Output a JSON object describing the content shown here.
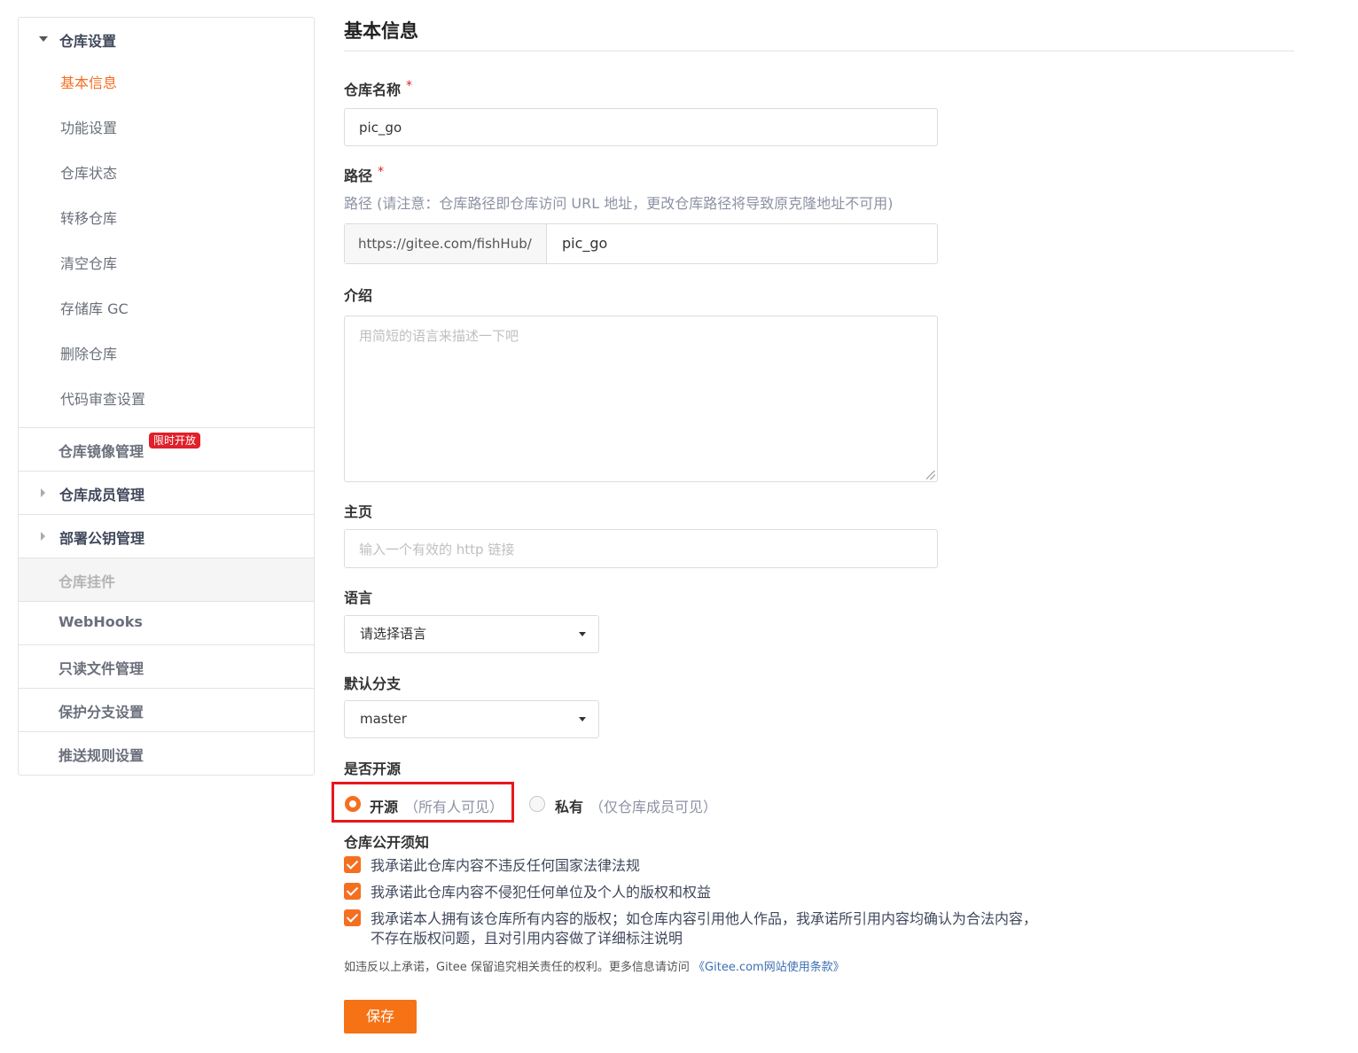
{
  "sidebar": {
    "settings_group": {
      "title": "仓库设置",
      "items": [
        "基本信息",
        "功能设置",
        "仓库状态",
        "转移仓库",
        "清空仓库",
        "存储库 GC",
        "删除仓库",
        "代码审查设置"
      ]
    },
    "mirror": {
      "title": "仓库镜像管理",
      "badge": "限时开放"
    },
    "members": {
      "title": "仓库成员管理"
    },
    "deploy_keys": {
      "title": "部署公钥管理"
    },
    "hooks": {
      "title": "仓库挂件"
    },
    "webhooks": {
      "title": "WebHooks"
    },
    "readonly": {
      "title": "只读文件管理"
    },
    "protect_branch": {
      "title": "保护分支设置"
    },
    "push_rules": {
      "title": "推送规则设置"
    }
  },
  "main": {
    "title": "基本信息",
    "repo_name": {
      "label": "仓库名称",
      "required": "*",
      "value": "pic_go"
    },
    "path": {
      "label": "路径",
      "required": "*",
      "hint": "路径 (请注意：仓库路径即仓库访问 URL 地址，更改仓库路径将导致原克隆地址不可用)",
      "prefix": "https://gitee.com/fishHub/",
      "value": "pic_go"
    },
    "intro": {
      "label": "介绍",
      "placeholder": "用简短的语言来描述一下吧"
    },
    "homepage": {
      "label": "主页",
      "placeholder": "输入一个有效的 http 链接"
    },
    "language": {
      "label": "语言",
      "selected": "请选择语言"
    },
    "default_branch": {
      "label": "默认分支",
      "selected": "master"
    },
    "visibility": {
      "label": "是否开源",
      "open_label": "开源",
      "open_note": "（所有人可见）",
      "private_label": "私有",
      "private_note": "（仅仓库成员可见）",
      "selected": "开源"
    },
    "notice": {
      "title": "仓库公开须知",
      "items": [
        "我承诺此仓库内容不违反任何国家法律法规",
        "我承诺此仓库内容不侵犯任何单位及个人的版权和权益",
        "我承诺本人拥有该仓库所有内容的版权；如仓库内容引用他人作品，我承诺所引用内容均确认为合法内容，",
        "不存在版权问题，且对引用内容做了详细标注说明"
      ],
      "footer": "如违反以上承诺，Gitee 保留追究相关责任的权利。更多信息请访问 ",
      "footer_link": "《Gitee.com网站使用条款》"
    },
    "save_label": "保存"
  },
  "colors": {
    "accent": "#f56f21",
    "badge": "#e0202a",
    "highlight": "#e8171d"
  }
}
